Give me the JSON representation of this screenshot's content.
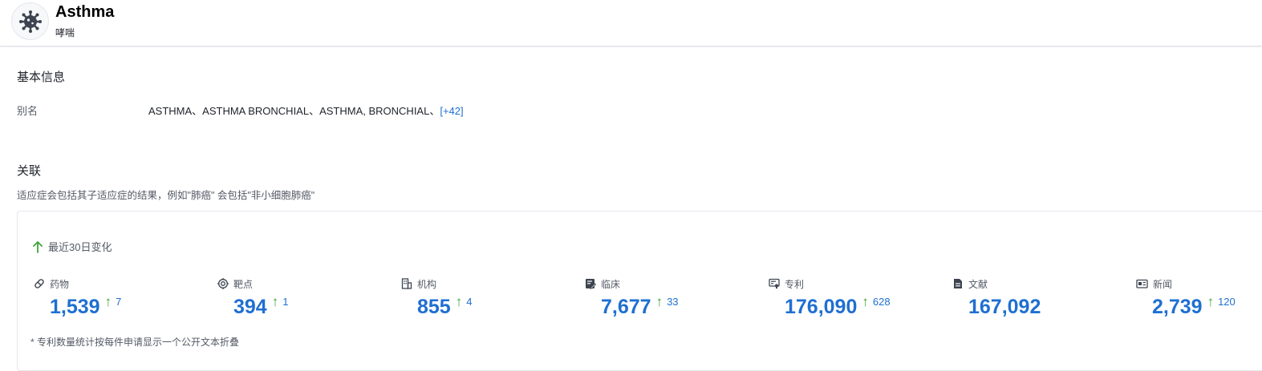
{
  "header": {
    "title": "Asthma",
    "subtitle": "哮喘",
    "icon": "virus-icon"
  },
  "basic": {
    "section_title": "基本信息",
    "alias_label": "别名",
    "alias_value": "ASTHMA、ASTHMA BRONCHIAL、ASTHMA, BRONCHIAL、",
    "alias_more": "[+42]"
  },
  "relation": {
    "section_title": "关联",
    "note": "适应症会包括其子适应症的结果，例如\"肺癌\" 会包括\"非小细胞肺癌\""
  },
  "panel": {
    "change_label": "最近30日变化",
    "stats": [
      {
        "label": "药物",
        "icon": "pill-icon",
        "value": "1,539",
        "delta": "7"
      },
      {
        "label": "靶点",
        "icon": "target-icon",
        "value": "394",
        "delta": "1"
      },
      {
        "label": "机构",
        "icon": "building-icon",
        "value": "855",
        "delta": "4"
      },
      {
        "label": "临床",
        "icon": "clinical-icon",
        "value": "7,677",
        "delta": "33"
      },
      {
        "label": "专利",
        "icon": "patent-icon",
        "value": "176,090",
        "delta": "628"
      },
      {
        "label": "文献",
        "icon": "document-icon",
        "value": "167,092",
        "delta": ""
      },
      {
        "label": "新闻",
        "icon": "news-icon",
        "value": "2,739",
        "delta": "120"
      }
    ],
    "footnote": "* 专利数量统计按每件申请显示一个公开文本折叠"
  },
  "colors": {
    "accent": "#1f6fd1",
    "increase": "#3fa33a",
    "muted": "#545a66"
  }
}
